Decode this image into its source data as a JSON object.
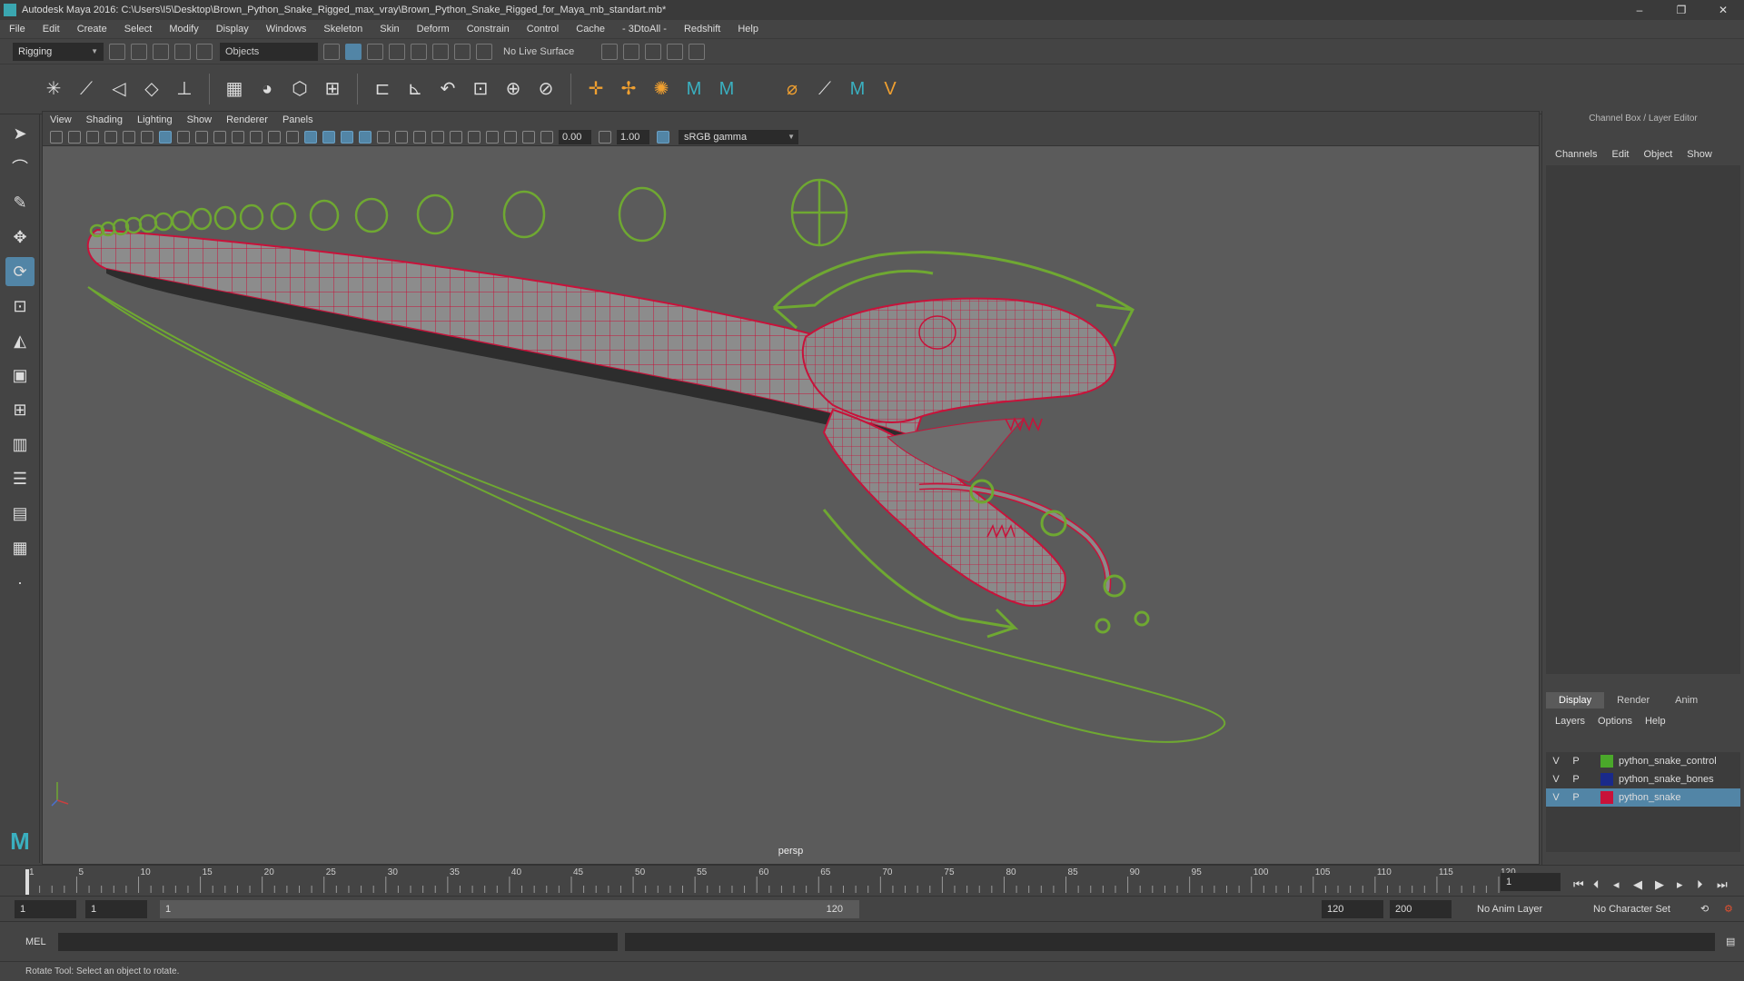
{
  "window": {
    "title": "Autodesk Maya 2016: C:\\Users\\I5\\Desktop\\Brown_Python_Snake_Rigged_max_vray\\Brown_Python_Snake_Rigged_for_Maya_mb_standart.mb*",
    "minimize": "–",
    "maximize": "❐",
    "close": "✕"
  },
  "menubar": [
    "File",
    "Edit",
    "Create",
    "Select",
    "Modify",
    "Display",
    "Windows",
    "Skeleton",
    "Skin",
    "Deform",
    "Constrain",
    "Control",
    "Cache",
    "- 3DtoAll -",
    "Redshift",
    "Help"
  ],
  "statusline": {
    "menuset": "Rigging",
    "selection_field": "Objects",
    "live_surface": "No Live Surface"
  },
  "viewport": {
    "menus": [
      "View",
      "Shading",
      "Lighting",
      "Show",
      "Renderer",
      "Panels"
    ],
    "exposure": "0.00",
    "gamma": "1.00",
    "color_management": "sRGB gamma",
    "camera_label": "persp"
  },
  "channel_box": {
    "title": "Channel Box / Layer Editor",
    "menus": [
      "Channels",
      "Edit",
      "Object",
      "Show"
    ]
  },
  "layer_editor": {
    "tabs": [
      "Display",
      "Render",
      "Anim"
    ],
    "active_tab": "Display",
    "menus": [
      "Layers",
      "Options",
      "Help"
    ],
    "layers": [
      {
        "v": "V",
        "p": "P",
        "color": "#4aa82a",
        "name": "python_snake_control",
        "selected": false
      },
      {
        "v": "V",
        "p": "P",
        "color": "#1a2a8a",
        "name": "python_snake_bones",
        "selected": false
      },
      {
        "v": "V",
        "p": "P",
        "color": "#c8123a",
        "name": "python_snake",
        "selected": true
      }
    ]
  },
  "timeslider": {
    "ticks": [
      "1",
      "5",
      "10",
      "15",
      "20",
      "25",
      "30",
      "35",
      "40",
      "45",
      "50",
      "55",
      "60",
      "65",
      "70",
      "75",
      "80",
      "85",
      "90",
      "95",
      "100",
      "105",
      "110",
      "115",
      "120"
    ],
    "current_frame": "1"
  },
  "rangeslider": {
    "start": "1",
    "playback_start": "1",
    "range_start_label": "1",
    "range_end_label": "120",
    "playback_end": "120",
    "end": "200",
    "anim_layer": "No Anim Layer",
    "character_set": "No Character Set"
  },
  "cmdline": {
    "label": "MEL"
  },
  "helpline": {
    "text": "Rotate Tool: Select an object to rotate."
  },
  "colors": {
    "control_curve": "#6fa832",
    "mesh_wire": "#c8123a",
    "mesh_fill": "#8a8a8a",
    "accent": "#5285a6"
  },
  "icons": {
    "tools": [
      "select-arrow-icon",
      "lasso-icon",
      "paint-select-icon",
      "move-icon",
      "rotate-icon",
      "scale-icon",
      "last-tool-icon"
    ],
    "shelf": [
      "joint-icon",
      "ik-handle-icon",
      "ik-spline-icon",
      "insert-joint-icon",
      "mirror-joint-icon",
      "bind-skin-icon",
      "smooth-bind-icon",
      "paint-weights-icon",
      "cluster-icon",
      "lattice-icon",
      "wrap-icon",
      "blendshape-icon"
    ]
  }
}
